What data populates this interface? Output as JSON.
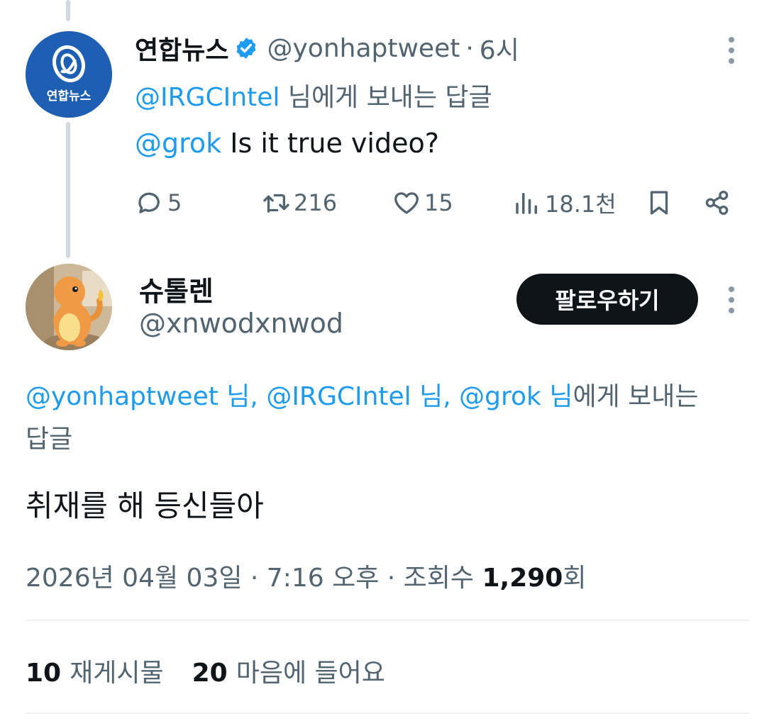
{
  "colors": {
    "link": "#1d9bf0",
    "secondary_text": "#536471",
    "primary_text": "#0f1419",
    "thread_line": "#cfd9de",
    "follow_button_bg": "#0f1419"
  },
  "parent_tweet": {
    "author_name": "연합뉴스",
    "verified": true,
    "handle": "@yonhaptweet",
    "separator": "·",
    "time": "6시",
    "avatar_text": "연합뉴스",
    "replying_to_handle": "@IRGCIntel",
    "replying_to_suffix": " 님에게 보내는 답글",
    "mention": "@grok",
    "text": " Is it true video?",
    "actions": {
      "replies": "5",
      "retweets": "216",
      "likes": "15",
      "views": "18.1천"
    }
  },
  "reply_tweet": {
    "author_name": "슈톨렌",
    "handle": "@xnwodxnwod",
    "follow_label": "팔로우하기",
    "replying_line1": {
      "handle1": "@yonhaptweet 님",
      "sep1": ", ",
      "handle2": "@IRGCIntel 님",
      "sep2": ", ",
      "handle3": "@grok 님",
      "suffix": "에게 보내는"
    },
    "replying_line2": "답글",
    "text": "취재를 해 등신들아",
    "timestamp": "2026년 04월 03일 · 7:16 오후 · 조회수 ",
    "views_count": "1,290",
    "views_unit": "회",
    "stats": {
      "retweets_count": "10",
      "retweets_label": "재게시물",
      "likes_count": "20",
      "likes_label": "마음에 들어요"
    }
  },
  "icons": [
    "verified-badge-icon",
    "more-icon",
    "reply-icon",
    "retweet-icon",
    "like-icon",
    "views-icon",
    "bookmark-icon",
    "share-icon"
  ]
}
